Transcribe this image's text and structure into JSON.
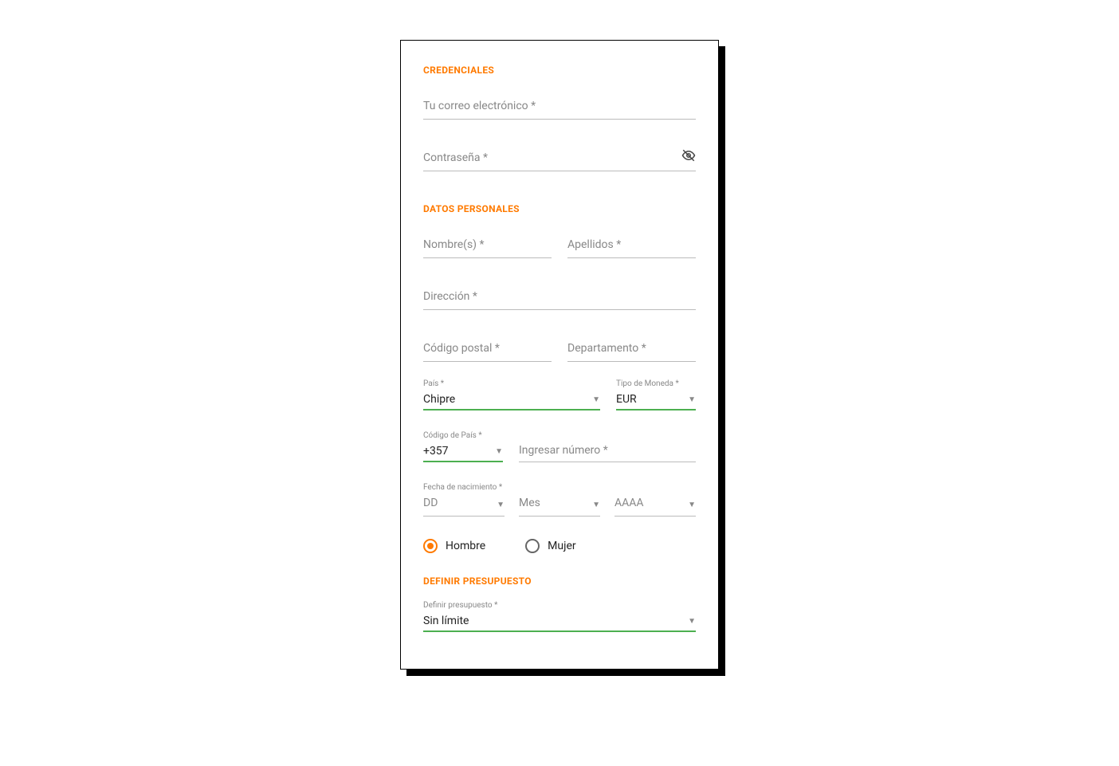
{
  "sections": {
    "credenciales": {
      "title": "CREDENCIALES",
      "email_label": "Tu correo electrónico *",
      "password_label": "Contraseña *"
    },
    "datos_personales": {
      "title": "DATOS PERSONALES",
      "nombres_label": "Nombre(s) *",
      "apellidos_label": "Apellidos *",
      "direccion_label": "Dirección *",
      "codigo_postal_label": "Código postal *",
      "departamento_label": "Departamento *",
      "pais_label": "País *",
      "pais_value": "Chipre",
      "moneda_label": "Tipo de Moneda *",
      "moneda_value": "EUR",
      "codigo_pais_label": "Código de País *",
      "codigo_pais_value": "+357",
      "numero_label": "Ingresar número *",
      "fecha_label": "Fecha de nacimiento *",
      "dia_placeholder": "DD",
      "mes_placeholder": "Mes",
      "anio_placeholder": "AAAA",
      "genero_hombre": "Hombre",
      "genero_mujer": "Mujer"
    },
    "presupuesto": {
      "title": "DEFINIR PRESUPUESTO",
      "definir_label": "Definir presupuesto *",
      "definir_value": "Sin límite"
    }
  }
}
